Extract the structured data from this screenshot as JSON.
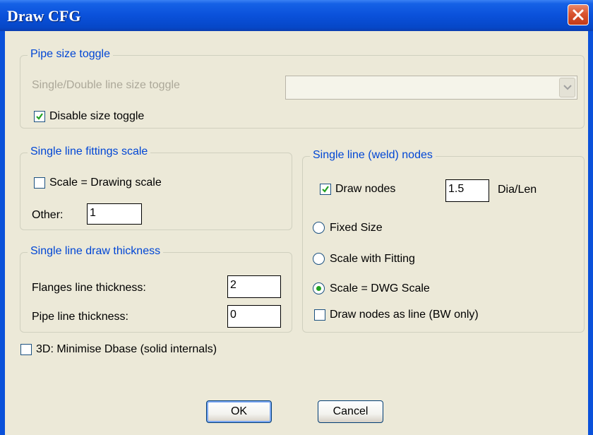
{
  "window": {
    "title": "Draw CFG"
  },
  "pipe_size": {
    "title": "Pipe size toggle",
    "toggle_label": "Single/Double line size toggle",
    "toggle_value": "",
    "disable_label": "Disable size toggle",
    "disable_checked": true
  },
  "fittings_scale": {
    "title": "Single line fittings scale",
    "scale_label": "Scale = Drawing scale",
    "scale_checked": false,
    "other_label": "Other:",
    "other_value": "1"
  },
  "thickness": {
    "title": "Single line draw thickness",
    "flanges_label": "Flanges line thickness:",
    "flanges_value": "2",
    "pipe_label": "Pipe line thickness:",
    "pipe_value": "0"
  },
  "weld_nodes": {
    "title": "Single line (weld) nodes",
    "draw_nodes_label": "Draw nodes",
    "draw_nodes_checked": true,
    "dia_value": "1.5",
    "dia_unit": "Dia/Len",
    "radio_fixed": "Fixed Size",
    "radio_fitting": "Scale with Fitting",
    "radio_dwg": "Scale = DWG Scale",
    "selected": "Scale = DWG Scale",
    "as_line_label": "Draw nodes as line (BW only)",
    "as_line_checked": false
  },
  "minimise": {
    "label": "3D: Minimise Dbase (solid internals)",
    "checked": false
  },
  "buttons": {
    "ok": "OK",
    "cancel": "Cancel"
  },
  "colors": {
    "title_bar": "#0a51da",
    "group_title": "#0046d5",
    "dialog_bg": "#ece9d8",
    "close_button": "#d9542f",
    "checkmark": "#21a121"
  }
}
